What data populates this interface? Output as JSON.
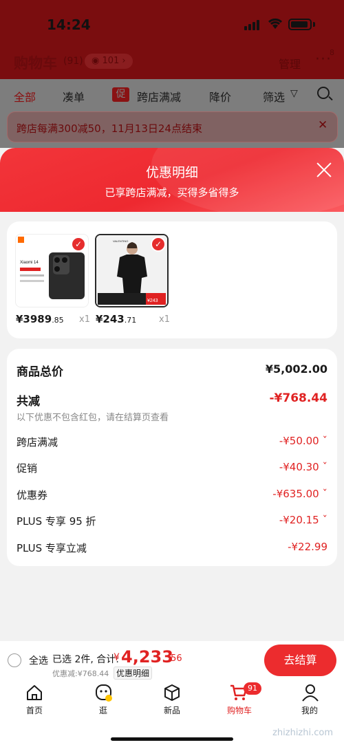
{
  "status_bar": {
    "time": "14:24"
  },
  "header": {
    "title": "购物车",
    "count": "(91)",
    "views": "101 ›",
    "manage": "管理",
    "more_badge": "8"
  },
  "tabs": [
    {
      "label": "全部",
      "active": true
    },
    {
      "label": "凑单"
    },
    {
      "label": "跨店满减",
      "badge": "促"
    },
    {
      "label": "降价"
    },
    {
      "label": "筛选"
    }
  ],
  "notice": {
    "text": "跨店每满300减50，11月13日24点结束"
  },
  "sheet": {
    "title": "优惠明细",
    "subtitle": "已享跨店满减，买得多省得多"
  },
  "products": [
    {
      "price_int": "¥3989",
      "price_dec": ".85",
      "qty": "x1",
      "img_text_brand": "Xiaomi 14"
    },
    {
      "price_int": "¥243",
      "price_dec": ".71",
      "qty": "x1",
      "img_text_brand": "VALENTINO",
      "img_price": "¥243"
    }
  ],
  "summary": {
    "total_label": "商品总价",
    "total_value": "¥5,002.00",
    "reduce_label": "共减",
    "reduce_value": "-¥768.44",
    "note": "以下优惠不包含红包，请在结算页查看",
    "rows": [
      {
        "label": "跨店满减",
        "value": "-¥50.00 ˇ"
      },
      {
        "label": "促销",
        "value": "-¥40.30 ˇ"
      },
      {
        "label": "优惠券",
        "value": "-¥635.00 ˇ"
      },
      {
        "label": "PLUS 专享 95 折",
        "value": "-¥20.15 ˇ"
      },
      {
        "label": "PLUS 专享立减",
        "value": "-¥22.99"
      }
    ]
  },
  "checkout_bar": {
    "select_all": "全选",
    "selected": "已选 2件, 合计:",
    "yen": "¥",
    "total_int": "4,233",
    "total_dec": ".56",
    "discount": "优惠减:¥768.44",
    "detail": "优惠明细",
    "button": "去结算"
  },
  "nav": [
    {
      "label": "首页",
      "icon": "home-icon"
    },
    {
      "label": "逛",
      "icon": "browse-icon"
    },
    {
      "label": "新品",
      "icon": "box-icon"
    },
    {
      "label": "购物车",
      "icon": "cart-icon",
      "active": true,
      "badge": "91"
    },
    {
      "label": "我的",
      "icon": "user-icon"
    }
  ],
  "watermark": "zhizhizhi.com",
  "colors": {
    "accent": "#e02222",
    "sheet_red": "#ee2930"
  }
}
